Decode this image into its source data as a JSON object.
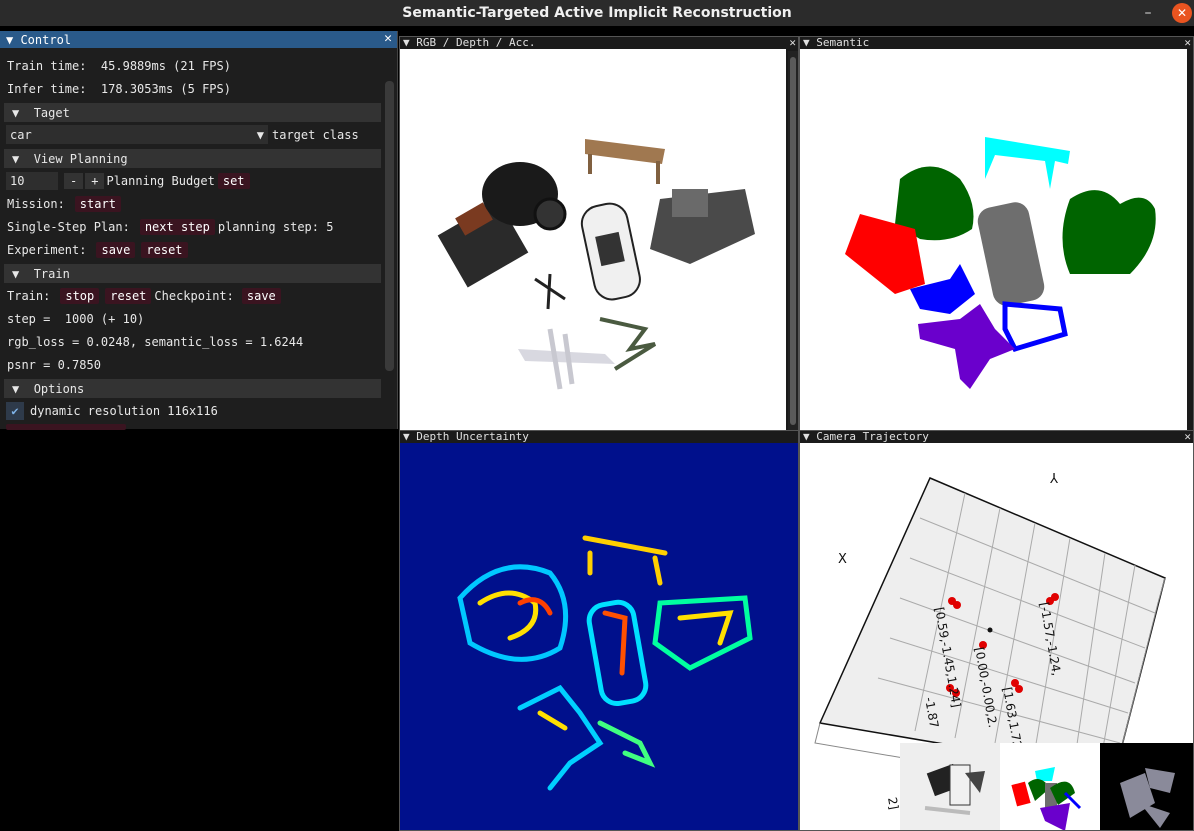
{
  "window": {
    "title": "Semantic-Targeted Active Implicit Reconstruction"
  },
  "control": {
    "title": "Control",
    "train_time": "Train time:  45.9889ms (21 FPS)",
    "infer_time": "Infer time:  178.3053ms (5 FPS)",
    "target_header": "Taget",
    "target_value": "car",
    "target_label": "target class",
    "view_header": "View Planning",
    "budget_value": "10",
    "minus": "-",
    "plus": "+",
    "budget_label": "Planning Budget",
    "set": "set",
    "mission_label": "Mission:",
    "start": "start",
    "single_step_label": "Single-Step Plan:",
    "next_step": "next step",
    "planning_step": "planning step: 5",
    "experiment_label": "Experiment:",
    "save": "save",
    "reset": "reset",
    "train_header": "Train",
    "train_label": "Train:",
    "stop": "stop",
    "reset2": "reset",
    "checkpoint_label": "Checkpoint:",
    "save2": "save",
    "step": "step =  1000 (+ 10)",
    "losses": "rgb_loss = 0.0248, semantic_loss = 1.6244",
    "psnr": "psnr = 0.7850",
    "options_header": "Options",
    "dynamic_resolution": "dynamic resolution 116x116"
  },
  "views": {
    "rgb_title": "RGB / Depth / Acc.",
    "semantic_title": "Semantic",
    "uncertainty_title": "Depth Uncertainty",
    "trajectory_title": "Camera Trajectory"
  },
  "trajectory": {
    "axis_x": "X",
    "axis_y": "Y",
    "label_a": "[0.59,-1.45,1.24]",
    "label_b": "[0.00,-0.00,2.",
    "label_c": "[-1.57,-1.24,",
    "label_d": "[1.63,1.72,-1",
    "label_e": "-1.87",
    "label_f": "2]"
  },
  "colors": {
    "accent": "#2a5a8a",
    "button": "#3a1420",
    "semantic_green": "#006400",
    "semantic_red": "#ff0000",
    "semantic_blue": "#0000ff",
    "semantic_cyan": "#00ffff",
    "semantic_gray": "#6e6e6e",
    "semantic_purple": "#6a00cc",
    "uncertainty_bg": "#00108c"
  }
}
